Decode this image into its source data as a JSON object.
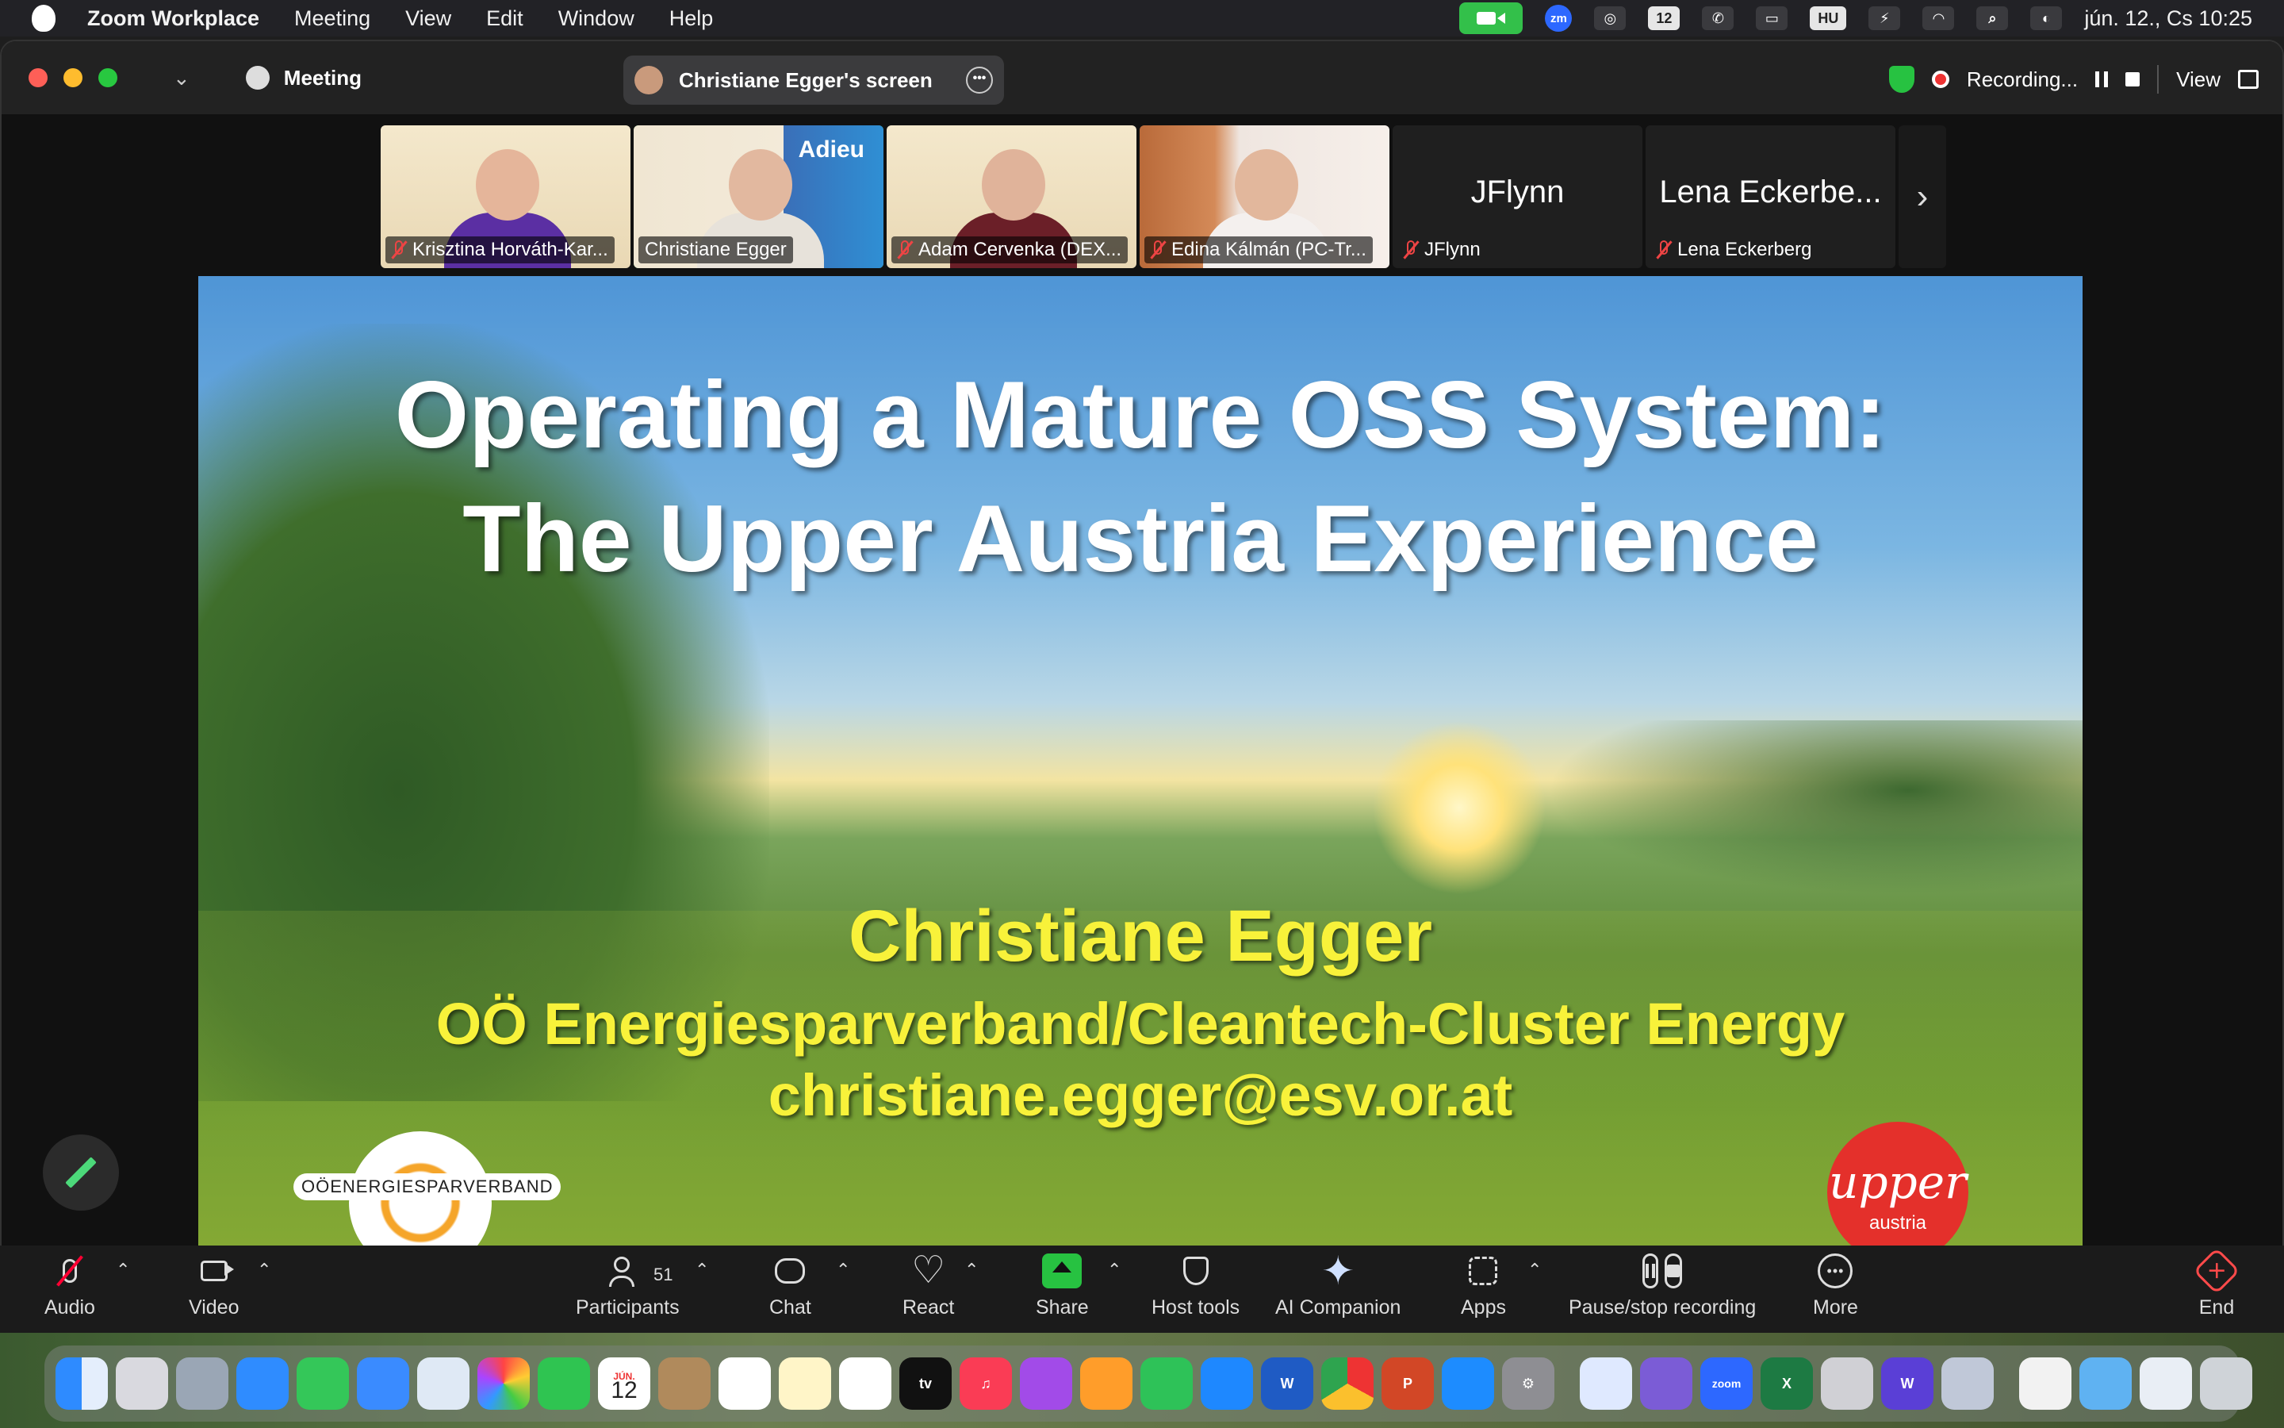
{
  "menubar": {
    "app": "Zoom Workplace",
    "items": [
      "Meeting",
      "View",
      "Edit",
      "Window",
      "Help"
    ],
    "calendar_badge": "12",
    "input_lang": "HU",
    "zoom_badge": "zm",
    "clock": "jún. 12., Cs 10:25"
  },
  "titlebar": {
    "meeting_label": "Meeting",
    "screen_label": "Christiane Egger's screen",
    "recording_label": "Recording...",
    "view_label": "View"
  },
  "gallery": {
    "tiles": [
      {
        "name": "Krisztina Horváth-Kar...",
        "muted": true
      },
      {
        "name": "Christiane Egger",
        "muted": false,
        "active": true,
        "sign": "Adieu"
      },
      {
        "name": "Adam Cervenka (DEX...",
        "muted": true
      },
      {
        "name": "Edina Kálmán (PC-Tr...",
        "muted": true
      },
      {
        "name": "JFlynn",
        "big": "JFlynn",
        "muted": true
      },
      {
        "name": "Lena Eckerberg",
        "big": "Lena Eckerbe...",
        "muted": true
      }
    ]
  },
  "slide": {
    "title_line1": "Operating a Mature OSS System:",
    "title_line2": "The Upper Austria Experience",
    "presenter": "Christiane Egger",
    "org": "OÖ Energiesparverband/Cleantech-Cluster Energy",
    "email": "christiane.egger@esv.or.at",
    "logo_left": "OÖENERGIESPARVERBAND",
    "logo_right_1": "upper",
    "logo_right_2": "austria"
  },
  "toolbar": {
    "audio": "Audio",
    "video": "Video",
    "participants": "Participants",
    "participants_count": "51",
    "chat": "Chat",
    "react": "React",
    "share": "Share",
    "host_tools": "Host tools",
    "ai_companion": "AI Companion",
    "apps": "Apps",
    "pause_stop": "Pause/stop recording",
    "more": "More",
    "end": "End"
  },
  "dock": {
    "calendar_month": "JÚN.",
    "calendar_day": "12",
    "tv": "tv",
    "zoom": "zoom"
  }
}
